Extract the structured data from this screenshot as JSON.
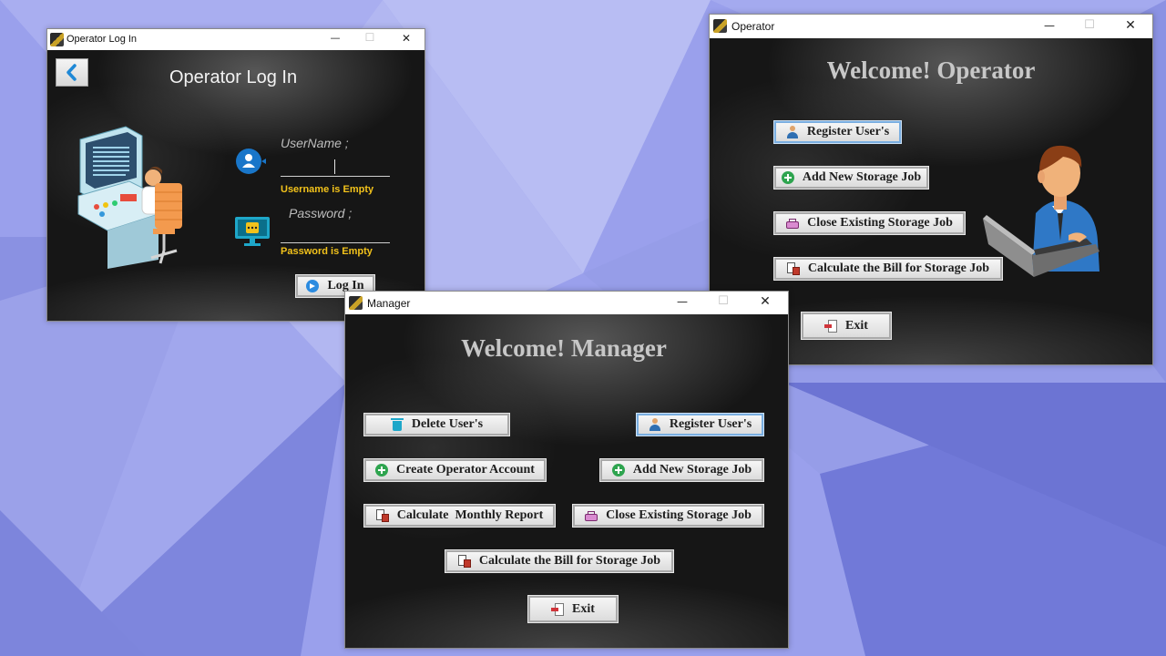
{
  "login_window": {
    "title": "Operator Log In",
    "heading": "Operator Log In",
    "username": {
      "placeholder": "UserName ;",
      "value": "",
      "error": "Username is Empty"
    },
    "password": {
      "placeholder": "Password ;",
      "value": "",
      "error": "Password is Empty"
    },
    "login_button": "Log In"
  },
  "operator_window": {
    "title": "Operator",
    "welcome": "Welcome! Operator",
    "buttons": {
      "register_users": "Register User's",
      "add_storage_job": "Add New Storage Job",
      "close_storage_job": "Close Existing Storage Job",
      "calculate_bill": "Calculate the Bill for Storage Job",
      "exit": "Exit"
    }
  },
  "manager_window": {
    "title": "Manager",
    "welcome": "Welcome! Manager",
    "buttons": {
      "delete_users": "Delete User's",
      "register_users": "Register User's",
      "create_operator": "Create Operator Account",
      "add_storage_job": "Add New Storage Job",
      "monthly_report": "Calculate  Monthly Report",
      "close_storage_job": "Close Existing Storage Job",
      "calculate_bill": "Calculate the Bill for Storage Job",
      "exit": "Exit"
    }
  },
  "window_controls": {
    "minimize": "—",
    "maximize": "☐",
    "close": "✕"
  },
  "colors": {
    "desktop": "#8f96e6",
    "error_text": "#f2c21b",
    "focus_border": "#7aaee0",
    "window_bg": "#161616"
  }
}
